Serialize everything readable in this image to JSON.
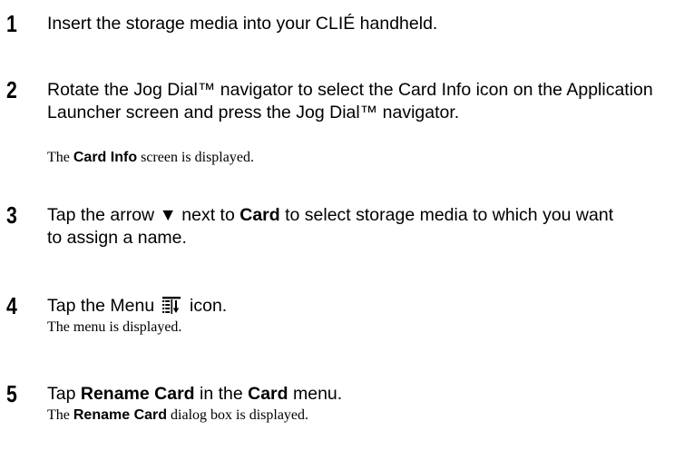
{
  "steps": [
    {
      "number": "1",
      "instruction": [
        {
          "text": "Insert the storage media into your CLIÉ handheld.",
          "bold": false
        }
      ]
    },
    {
      "number": "2",
      "instruction": [
        {
          "text": "Rotate the Jog Dial™ navigator to select the Card Info icon on the Application Launcher screen and press the Jog Dial™ navigator.",
          "bold": false
        }
      ],
      "result": [
        {
          "text": "The ",
          "bold": false
        },
        {
          "text": "Card Info",
          "bold": true
        },
        {
          "text": " screen is displayed.",
          "bold": false
        }
      ]
    },
    {
      "number": "3",
      "instruction": [
        {
          "text": "Tap the arrow ▼ next to ",
          "bold": false
        },
        {
          "text": "Card",
          "bold": true
        },
        {
          "text": " to select storage media to which you want to assign a name.",
          "bold": false
        }
      ]
    },
    {
      "number": "4",
      "instruction": [
        {
          "text": "Tap the Menu ",
          "bold": false
        },
        {
          "icon": "menu-icon"
        },
        {
          "text": " icon.",
          "bold": false
        }
      ],
      "result": [
        {
          "text": "The menu is displayed.",
          "bold": false
        }
      ]
    },
    {
      "number": "5",
      "instruction": [
        {
          "text": "Tap ",
          "bold": false
        },
        {
          "text": "Rename Card",
          "bold": true
        },
        {
          "text": " in the ",
          "bold": false
        },
        {
          "text": "Card",
          "bold": true
        },
        {
          "text": " menu.",
          "bold": false
        }
      ],
      "result": [
        {
          "text": "The ",
          "bold": false
        },
        {
          "text": "Rename Card",
          "bold": true
        },
        {
          "text": " dialog box is displayed.",
          "bold": false
        }
      ]
    }
  ]
}
